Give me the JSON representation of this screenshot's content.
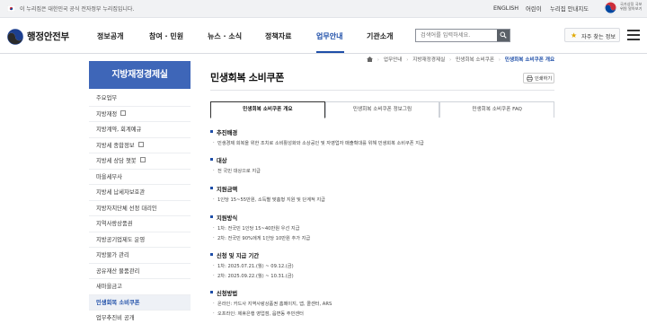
{
  "gov_banner": {
    "notice": "이 누리집은 대한민국 공식 전자정부 누리집입니다.",
    "links": [
      "ENGLISH",
      "어린이",
      "누리집 안내지도"
    ],
    "emblem_text": "국가상징 국보위원 알아보기"
  },
  "header": {
    "site_title": "행정안전부",
    "gnb": [
      "정보공개",
      "참여 · 민원",
      "뉴스 · 소식",
      "정책자료",
      "업무안내",
      "기관소개"
    ],
    "active_gnb": "업무안내",
    "search_placeholder": "검색어를 입력하세요.",
    "fav_label": "자주 찾는 정보"
  },
  "lnb": {
    "title": "지방재정경제실",
    "items": [
      {
        "label": "주요업무",
        "external": false
      },
      {
        "label": "지방재정",
        "external": true
      },
      {
        "label": "지방계약, 회계예규",
        "external": false
      },
      {
        "label": "지방세 종합정보",
        "external": true
      },
      {
        "label": "지방세 상담 챗봇",
        "external": true
      },
      {
        "label": "마을세무사",
        "external": false
      },
      {
        "label": "지방세 납세자보호관",
        "external": false
      },
      {
        "label": "지방자치단체 선정 대리인",
        "external": false
      },
      {
        "label": "지역사랑상품권",
        "external": false
      },
      {
        "label": "지방공기업제도 운영",
        "external": false
      },
      {
        "label": "지방물가 관리",
        "external": false
      },
      {
        "label": "공유재산 물품관리",
        "external": false
      },
      {
        "label": "새마을금고",
        "external": false
      },
      {
        "label": "민생회복 소비쿠폰",
        "external": false,
        "active": true
      },
      {
        "label": "업무추진비 공개",
        "external": false
      }
    ]
  },
  "breadcrumb": [
    "업무안내",
    "지방재정경제실",
    "민생회복 소비쿠폰",
    "민생회복 소비쿠폰 개요"
  ],
  "page_title": "민생회복 소비쿠폰",
  "print_label": "인쇄하기",
  "tabs": [
    "민생회복 소비쿠폰 개요",
    "민생회복 소비쿠폰 정보그림",
    "민생회복 소비쿠폰 FAQ"
  ],
  "sections": [
    {
      "title": "추진배경",
      "lines": [
        "민생경제 회복을 위한 조치로 소비활성화와 소상공인 및 자영업자 매출확대를 위해 민생회복 소비쿠폰 지급"
      ]
    },
    {
      "title": "대상",
      "lines": [
        "전 국민 대상으로 지급"
      ]
    },
    {
      "title": "지원금액",
      "lines": [
        "1인당 15~55만원, 소득별 맞춤형 지원 및 단계적 지급"
      ]
    },
    {
      "title": "지원방식",
      "lines": [
        "1차: 전국민 1인당 15~40만원 우선 지급",
        "2차: 전국민 90%에게 1인당 10만원 추가 지급"
      ]
    },
    {
      "title": "신청 및 지급 기간",
      "lines": [
        "1차: 2025.07.21.(월) ~ 09.12.(금)",
        "2차: 2025.09.22.(월) ~ 10.31.(금)"
      ]
    },
    {
      "title": "신청방법",
      "lines": [
        "온라인: 카드사 지역사랑상품권 홈페이지, 앱, 콜센터, ARS",
        "오프라인: 제휴은행 영업점, 읍면동 주민센터"
      ]
    }
  ]
}
